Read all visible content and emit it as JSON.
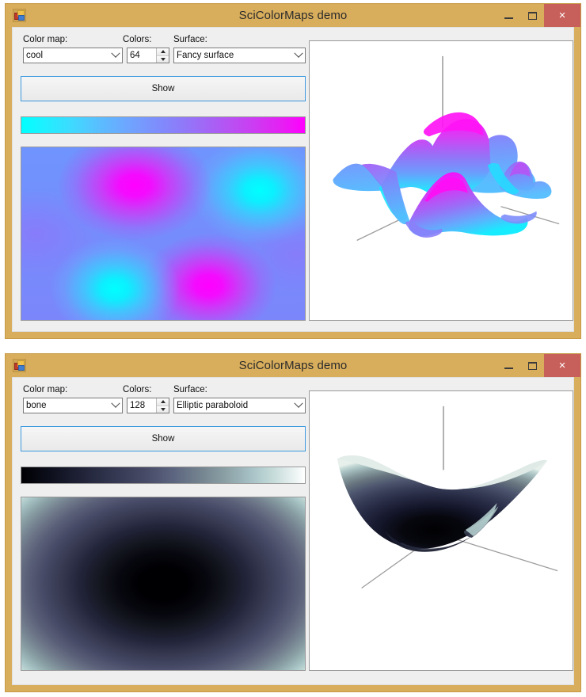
{
  "windows": [
    {
      "title": "SciColorMaps demo",
      "icon": "vs-form-icon",
      "controls": {
        "minimize_label": "—",
        "maximize_label": "□",
        "close_label": "×"
      },
      "form": {
        "colormap_label": "Color map:",
        "colormap_value": "cool",
        "colors_label": "Colors:",
        "colors_value": "64",
        "surface_label": "Surface:",
        "surface_value": "Fancy surface",
        "show_label": "Show"
      },
      "colorbar": {
        "name": "cool",
        "stops": [
          "#00ffff",
          "#3fd9ff",
          "#6fa4ff",
          "#8189fc",
          "#b455f3",
          "#e61ff3",
          "#ff00ff"
        ]
      },
      "preview_2d": {
        "name": "cool-heatmap",
        "description": "Quadrant interference field: magenta peaks upper-left and lower-right, cyan peaks upper-right and lower-left"
      },
      "preview_3d": {
        "name": "fancy-surface-3d",
        "description": "Peaks-like 3D surface rendered with the cool colormap, magenta crests and cyan troughs"
      }
    },
    {
      "title": "SciColorMaps demo",
      "icon": "vs-form-icon",
      "controls": {
        "minimize_label": "—",
        "maximize_label": "□",
        "close_label": "×"
      },
      "form": {
        "colormap_label": "Color map:",
        "colormap_value": "bone",
        "colors_label": "Colors:",
        "colors_value": "128",
        "surface_label": "Surface:",
        "surface_value": "Elliptic paraboloid",
        "show_label": "Show"
      },
      "colorbar": {
        "name": "bone",
        "stops": [
          "#000003",
          "#1e2135",
          "#474b67",
          "#74838f",
          "#a6c1c6",
          "#e4eeee",
          "#ffffff"
        ]
      },
      "preview_2d": {
        "name": "bone-heatmap",
        "description": "Radial elliptic gradient, black at center fading through slate blue to white at the corners"
      },
      "preview_3d": {
        "name": "elliptic-paraboloid-3d",
        "description": "Upward-opening elliptic paraboloid bowl rendered with the bone colormap"
      }
    }
  ],
  "theme": {
    "titlebar": "#d8ad5c",
    "close_button": "#c75f5a",
    "client_background": "#efefef",
    "focus_border": "#3c9ade",
    "axis_line": "#9e9e9e"
  }
}
